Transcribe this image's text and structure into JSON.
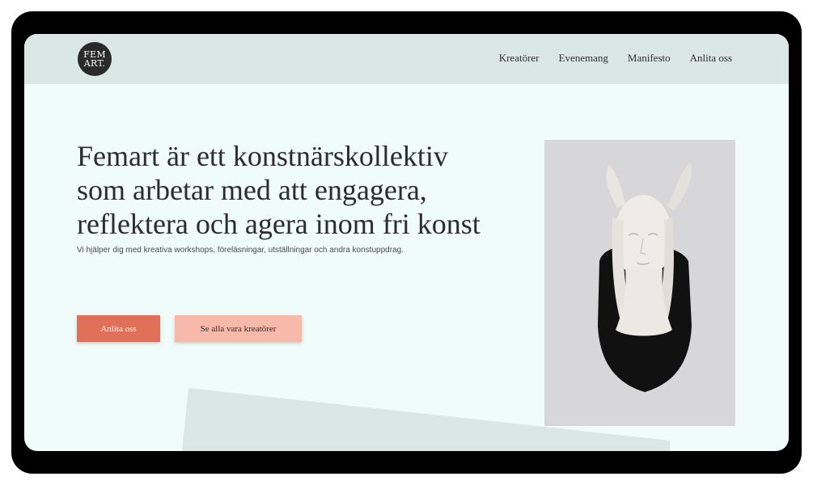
{
  "brand": {
    "logo_line1": "FEM",
    "logo_line2": "ART."
  },
  "nav": {
    "items": [
      {
        "label": "Kreatörer"
      },
      {
        "label": "Evenemang"
      },
      {
        "label": "Manifesto"
      },
      {
        "label": "Anlita oss"
      }
    ]
  },
  "hero": {
    "title_line1": "Femart är ett konstnärskollektiv",
    "title_line2": "som arbetar med att engagera,",
    "title_line3": "reflektera och agera inom fri konst",
    "subtitle": "Vi hjälper dig med kreativa workshops, föreläsningar, utställningar och andra konstuppdrag.",
    "primary_button": "Anlita oss",
    "secondary_button": "Se alla vara kreatörer"
  },
  "colors": {
    "page_bg": "#effcfa",
    "header_bg": "#dbe7e4",
    "accent_primary": "#e07058",
    "accent_secondary": "#f7b9aa",
    "text": "#2c2c2c"
  }
}
